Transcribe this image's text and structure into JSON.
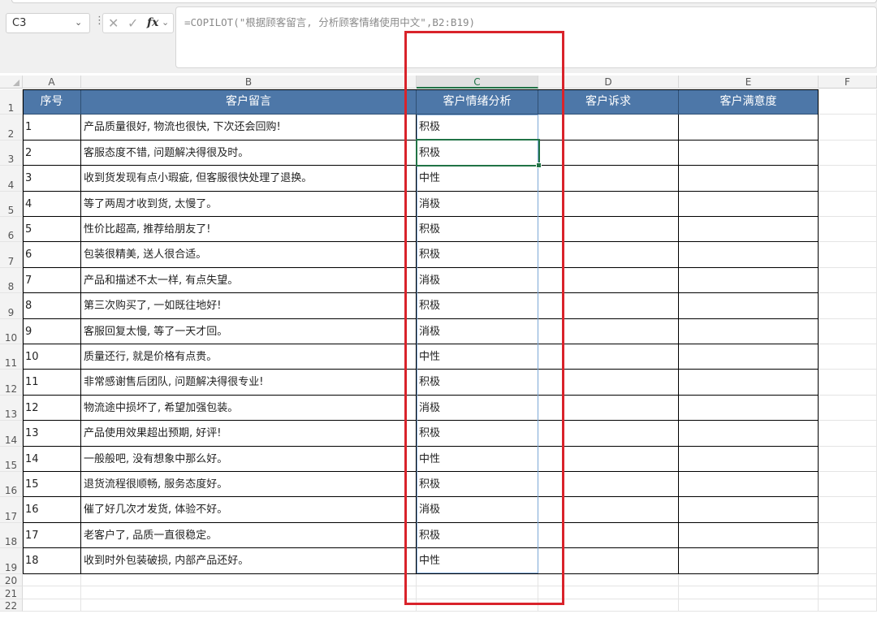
{
  "name_box": {
    "value": "C3",
    "dropdown": "⌄"
  },
  "formula_bar": {
    "menu_dots": "⋮",
    "cancel": "✕",
    "enter": "✓",
    "fx": "fx",
    "fx_dropdown": "⌄",
    "formula": "=COPILOT(\"根据顾客留言, 分析顾客情绪使用中文\",B2:B19)"
  },
  "columns": [
    "A",
    "B",
    "C",
    "D",
    "E",
    "F"
  ],
  "selected_column": "C",
  "selected_cell": "C3",
  "header_row": {
    "A": "序号",
    "B": "客户留言",
    "C": "客户情绪分析",
    "D": "客户诉求",
    "E": "客户满意度"
  },
  "rows": [
    {
      "row": "2",
      "A": "1",
      "B": "产品质量很好, 物流也很快, 下次还会回购!",
      "C": "积极",
      "D": "",
      "E": ""
    },
    {
      "row": "3",
      "A": "2",
      "B": "客服态度不错, 问题解决得很及时。",
      "C": "积极",
      "D": "",
      "E": ""
    },
    {
      "row": "4",
      "A": "3",
      "B": "收到货发现有点小瑕疵, 但客服很快处理了退换。",
      "C": "中性",
      "D": "",
      "E": ""
    },
    {
      "row": "5",
      "A": "4",
      "B": "等了两周才收到货, 太慢了。",
      "C": "消极",
      "D": "",
      "E": ""
    },
    {
      "row": "6",
      "A": "5",
      "B": "性价比超高, 推荐给朋友了!",
      "C": "积极",
      "D": "",
      "E": ""
    },
    {
      "row": "7",
      "A": "6",
      "B": "包装很精美, 送人很合适。",
      "C": "积极",
      "D": "",
      "E": ""
    },
    {
      "row": "8",
      "A": "7",
      "B": "产品和描述不太一样, 有点失望。",
      "C": "消极",
      "D": "",
      "E": ""
    },
    {
      "row": "9",
      "A": "8",
      "B": "第三次购买了, 一如既往地好!",
      "C": "积极",
      "D": "",
      "E": ""
    },
    {
      "row": "10",
      "A": "9",
      "B": "客服回复太慢, 等了一天才回。",
      "C": "消极",
      "D": "",
      "E": ""
    },
    {
      "row": "11",
      "A": "10",
      "B": "质量还行, 就是价格有点贵。",
      "C": "中性",
      "D": "",
      "E": ""
    },
    {
      "row": "12",
      "A": "11",
      "B": "非常感谢售后团队, 问题解决得很专业!",
      "C": "积极",
      "D": "",
      "E": ""
    },
    {
      "row": "13",
      "A": "12",
      "B": "物流途中损坏了, 希望加强包装。",
      "C": "消极",
      "D": "",
      "E": ""
    },
    {
      "row": "14",
      "A": "13",
      "B": "产品使用效果超出预期, 好评!",
      "C": "积极",
      "D": "",
      "E": ""
    },
    {
      "row": "15",
      "A": "14",
      "B": "一般般吧, 没有想象中那么好。",
      "C": "中性",
      "D": "",
      "E": ""
    },
    {
      "row": "16",
      "A": "15",
      "B": "退货流程很顺畅, 服务态度好。",
      "C": "积极",
      "D": "",
      "E": ""
    },
    {
      "row": "17",
      "A": "16",
      "B": "催了好几次才发货, 体验不好。",
      "C": "消极",
      "D": "",
      "E": ""
    },
    {
      "row": "18",
      "A": "17",
      "B": "老客户了, 品质一直很稳定。",
      "C": "积极",
      "D": "",
      "E": ""
    },
    {
      "row": "19",
      "A": "18",
      "B": "收到时外包装破损, 内部产品还好。",
      "C": "中性",
      "D": "",
      "E": ""
    }
  ],
  "empty_rows": [
    "20",
    "21",
    "22"
  ],
  "header_row_number": "1",
  "colors": {
    "header_fill": "#4d77a8",
    "selection": "#217346",
    "highlight_box": "#d9232b"
  }
}
